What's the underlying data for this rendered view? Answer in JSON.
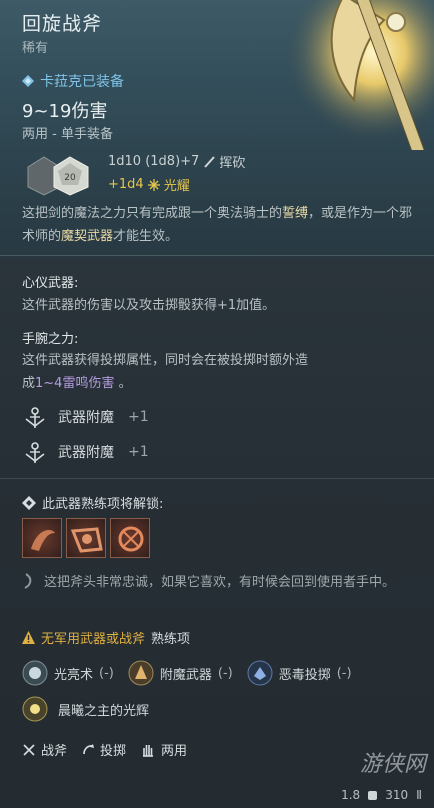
{
  "item": {
    "title": "回旋战斧",
    "rarity": "稀有",
    "equipped_by": "卡菈克已装备",
    "damage_range": "9~19伤害",
    "handedness": "两用 - 单手装备",
    "damage_line_1": "1d10 (1d8)+7",
    "damage_type_1": "挥砍",
    "damage_line_2": "+1d4",
    "damage_type_2": "光耀",
    "dice_value": "20",
    "description_prefix": "这把剑的魔法之力只有完成跟一个奥法骑士的",
    "description_oath": "誓缚",
    "description_mid": "，或是作为一个邪术师的",
    "description_pact": "魔契武器",
    "description_suffix": "才能生效。"
  },
  "traits": {
    "t1_head": "心仪武器:",
    "t1_body": "这件武器的伤害以及攻击掷骰获得+1加值。",
    "t2_head": "手腕之力:",
    "t2_body_a": "这件武器获得投掷属性，同时会在被投掷时额外造",
    "t2_body_b": "成",
    "t2_purple": "1~4雷鸣伤害",
    "t2_end": "。"
  },
  "enchantments": [
    {
      "label": "武器附魔",
      "value": "+1"
    },
    {
      "label": "武器附魔",
      "value": "+1"
    }
  ],
  "proficiency": {
    "unlock_text": "此武器熟练项将解锁:",
    "loyal_text": "这把斧头非常忠诚，如果它喜欢，有时候会回到使用者手中。",
    "warn_colored": "无军用武器或战斧",
    "warn_plain": "熟练项"
  },
  "spells": [
    {
      "name": "光亮术",
      "paren": "(-)"
    },
    {
      "name": "附魔武器",
      "paren": "(-)"
    },
    {
      "name": "恶毒投掷",
      "paren": "(-)"
    }
  ],
  "spell_extra": "晨曦之主的光辉",
  "tags": [
    {
      "label": "战斧",
      "icon": "axe-icon"
    },
    {
      "label": "投掷",
      "icon": "throw-icon"
    },
    {
      "label": "两用",
      "icon": "hand-icon"
    }
  ],
  "footer": {
    "weight": "1.8",
    "price": "310"
  },
  "watermark": "游侠网",
  "colors": {
    "gold": "#e6c64a",
    "purple": "#b59ce0",
    "blue": "#7fc4e8"
  }
}
